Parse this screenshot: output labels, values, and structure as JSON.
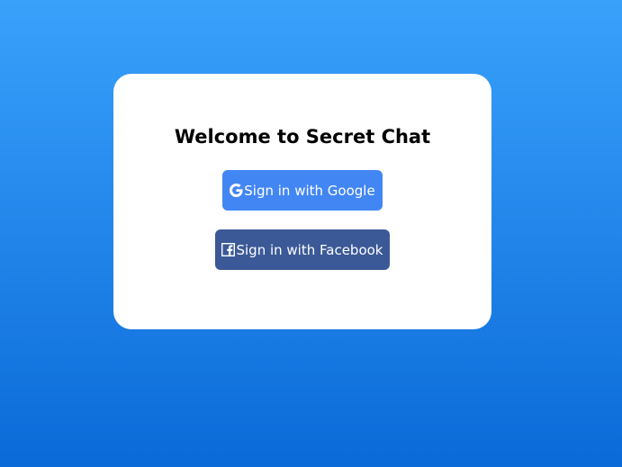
{
  "card": {
    "title": "Welcome to Secret Chat",
    "buttons": [
      {
        "label": "Sign in with Google",
        "icon": "google-icon",
        "color": "#4286f4"
      },
      {
        "label": "Sign in with Facebook",
        "icon": "facebook-icon",
        "color": "#3b5997"
      }
    ]
  },
  "background": {
    "gradient_top": "#3aa1fb",
    "gradient_bottom": "#0a6ad8"
  }
}
